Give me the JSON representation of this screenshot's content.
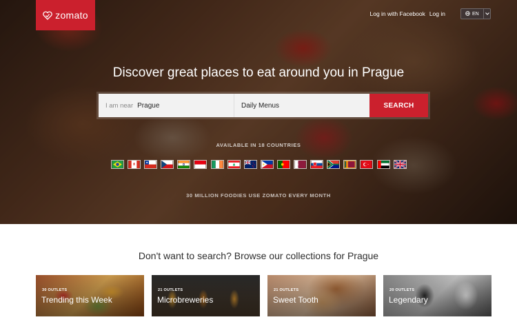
{
  "brand": {
    "name": "zomato",
    "color": "#cb202d"
  },
  "nav": {
    "facebook_login": "Log in with Facebook",
    "login": "Log in",
    "language": "EN"
  },
  "hero": {
    "headline": "Discover great places to eat around you in Prague",
    "search": {
      "location_prefix": "I am near",
      "location_value": "Prague",
      "query_value": "Daily Menus",
      "button_label": "SEARCH"
    },
    "available_text": "AVAILABLE IN 18 COUNTRIES",
    "countries": [
      "brazil-flag-icon",
      "canada-flag-icon",
      "chile-flag-icon",
      "czech-flag-icon",
      "india-flag-icon",
      "indonesia-flag-icon",
      "ireland-flag-icon",
      "lebanon-flag-icon",
      "new-zealand-flag-icon",
      "philippines-flag-icon",
      "portugal-flag-icon",
      "qatar-flag-icon",
      "slovakia-flag-icon",
      "south-africa-flag-icon",
      "sri-lanka-flag-icon",
      "turkey-flag-icon",
      "uae-flag-icon",
      "uk-flag-icon"
    ],
    "foodies_text": "30 MILLION FOODIES USE ZOMATO EVERY MONTH"
  },
  "collections": {
    "title": "Don't want to search? Browse our collections for Prague",
    "cards": [
      {
        "outlets": "30 OUTLETS",
        "title": "Trending this Week"
      },
      {
        "outlets": "21 OUTLETS",
        "title": "Microbreweries"
      },
      {
        "outlets": "21 OUTLETS",
        "title": "Sweet Tooth"
      },
      {
        "outlets": "20 OUTLETS",
        "title": "Legendary"
      }
    ]
  }
}
